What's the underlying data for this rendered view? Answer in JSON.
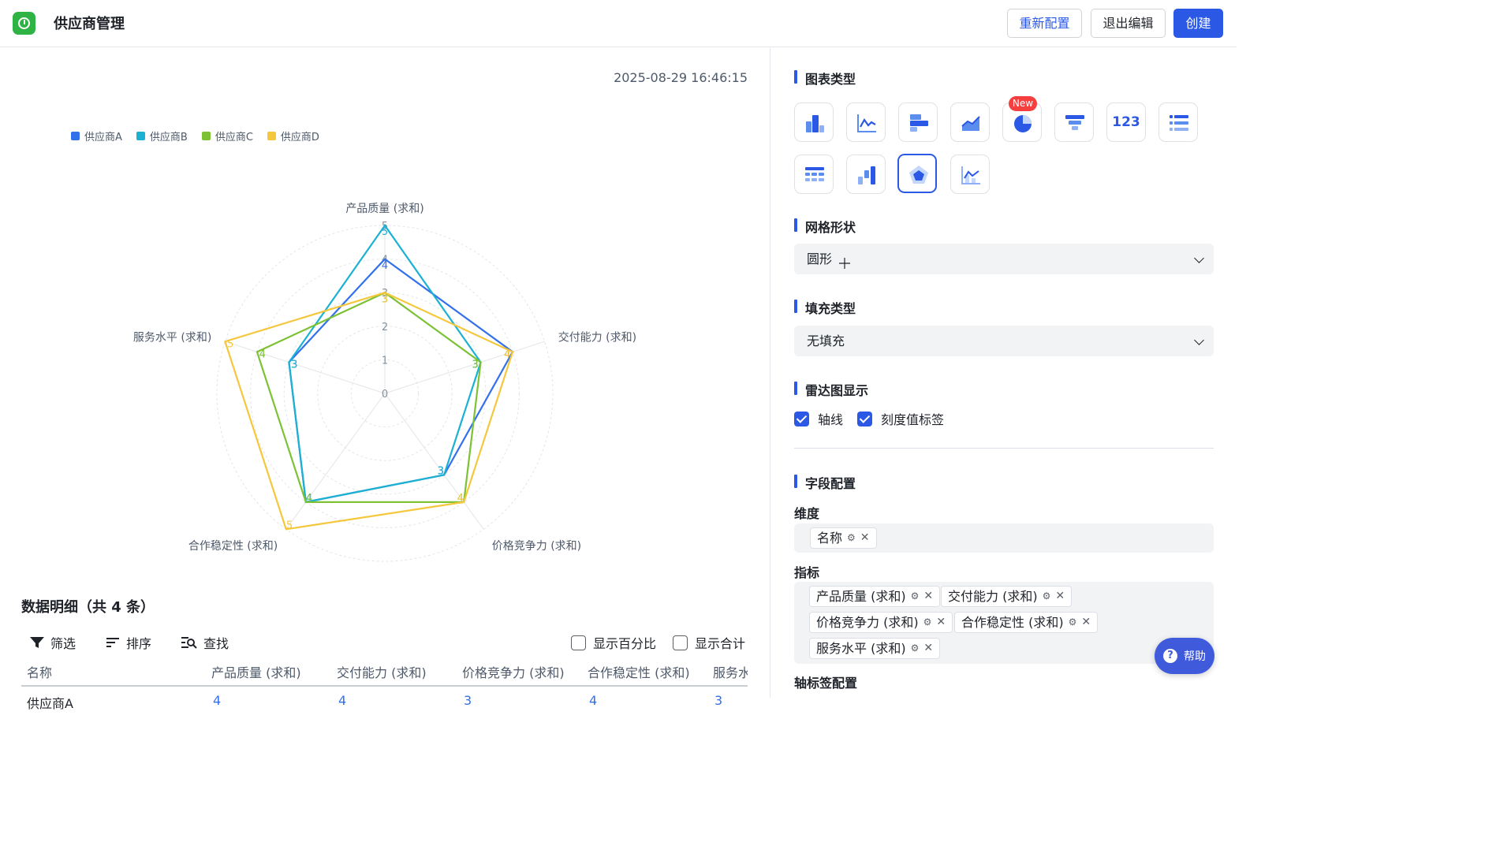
{
  "header": {
    "title": "供应商管理",
    "reconfigure": "重新配置",
    "exit_edit": "退出编辑",
    "create": "创建"
  },
  "chart_panel": {
    "timestamp": "2025-08-29 16:46:15"
  },
  "chart_data": {
    "type": "radar",
    "indicators": [
      "产品质量 (求和)",
      "交付能力 (求和)",
      "价格竞争力 (求和)",
      "合作稳定性 (求和)",
      "服务水平 (求和)"
    ],
    "rlim": [
      0,
      5
    ],
    "ticks": [
      "0",
      "1",
      "2",
      "3",
      "4",
      "5"
    ],
    "grid_shape": "circle",
    "legend_position": "top-left",
    "series": [
      {
        "name": "供应商A",
        "color": "#3370eb",
        "values": [
          4,
          4,
          3,
          4,
          3
        ]
      },
      {
        "name": "供应商B",
        "color": "#1bb1d3",
        "values": [
          5,
          3,
          3,
          4,
          3
        ]
      },
      {
        "name": "供应商C",
        "color": "#7cc234",
        "values": [
          3,
          3,
          4,
          4,
          4
        ]
      },
      {
        "name": "供应商D",
        "color": "#f5c73c",
        "values": [
          3,
          4,
          4,
          5,
          5
        ]
      }
    ]
  },
  "details": {
    "title": "数据明细（共 4 条）",
    "filter": "筛选",
    "sort": "排序",
    "find": "查找",
    "show_percent": "显示百分比",
    "show_total": "显示合计",
    "columns": [
      "名称",
      "产品质量 (求和)",
      "交付能力 (求和)",
      "价格竞争力 (求和)",
      "合作稳定性 (求和)",
      "服务水平 (求和)"
    ],
    "first_row": [
      "供应商A",
      "4",
      "4",
      "3",
      "4",
      "3"
    ]
  },
  "config": {
    "chart_type_title": "图表类型",
    "new_badge": "New",
    "chart_type_icons": [
      "bar-chart-icon",
      "line-chart-icon",
      "horizontal-bar-icon",
      "area-chart-icon",
      "pie-chart-icon",
      "funnel-chart-icon",
      "number-card-icon",
      "list-icon",
      "table-icon",
      "waterfall-icon",
      "radar-chart-icon",
      "combo-chart-icon"
    ],
    "number_card_text": "123",
    "grid_shape_title": "网格形状",
    "grid_shape_value": "圆形",
    "fill_type_title": "填充类型",
    "fill_type_value": "无填充",
    "radar_display_title": "雷达图显示",
    "axis_line_label": "轴线",
    "tick_label_label": "刻度值标签",
    "field_config_title": "字段配置",
    "dimension_label": "维度",
    "dimension_tags": [
      "名称"
    ],
    "metric_label": "指标",
    "metric_tags": [
      "产品质量 (求和)",
      "交付能力 (求和)",
      "价格竞争力 (求和)",
      "合作稳定性 (求和)",
      "服务水平 (求和)"
    ],
    "axis_label_config": "轴标签配置",
    "help": "帮助"
  }
}
